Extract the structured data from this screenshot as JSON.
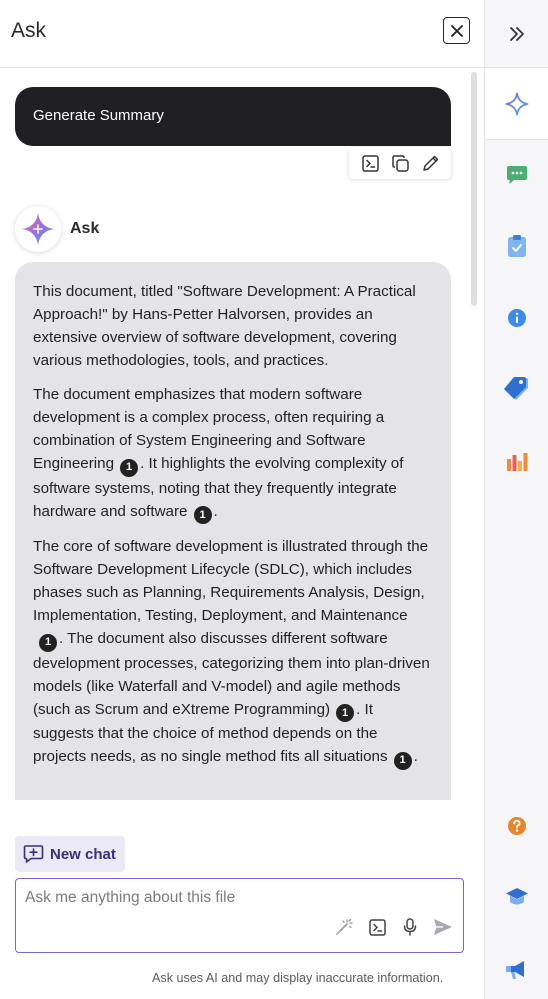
{
  "panel": {
    "title": "Ask",
    "close_label": "close"
  },
  "conversation": {
    "user_message": "Generate Summary",
    "bot_name": "Ask",
    "answer": {
      "p1": "This document, titled \"Software Development: A Practical Approach!\" by Hans-Petter Halvorsen, provides an extensive overview of software development, covering various methodologies, tools, and practices.",
      "p2a": "The document emphasizes that modern software development is a complex process, often requiring a combination of System Engineering and Software Engineering",
      "p2b": ". It highlights the evolving complexity of software systems, noting that they frequently integrate hardware and software",
      "p2c": ".",
      "p3a": "The core of software development is illustrated through the Software Development Lifecycle (SDLC), which includes phases such as Planning, Requirements Analysis, Design, Implementation, Testing, Deployment, and Maintenance",
      "p3b": ". The document also discusses different software development processes, categorizing them into plan-driven models (like Waterfall and V-model) and agile methods (such as Scrum and eXtreme Programming)",
      "p3c": ". It suggests that the choice of method depends on the projects needs, as no single method fits all situations",
      "p3d": ".",
      "citation": "1"
    }
  },
  "footer": {
    "new_chat_label": "New chat",
    "input_placeholder": "Ask me anything about this file",
    "disclaimer": "Ask uses AI and may display inaccurate information."
  },
  "colors": {
    "accent": "#7a64d8",
    "user_bubble": "#202024",
    "answer_bubble": "#e4e4e8"
  },
  "rail_icons": [
    "collapse-icon",
    "ask-sparkle-icon",
    "chat-icon",
    "clipboard-icon",
    "info-icon",
    "tag-icon",
    "chart-icon",
    "help-icon",
    "learn-icon",
    "announcement-icon"
  ]
}
